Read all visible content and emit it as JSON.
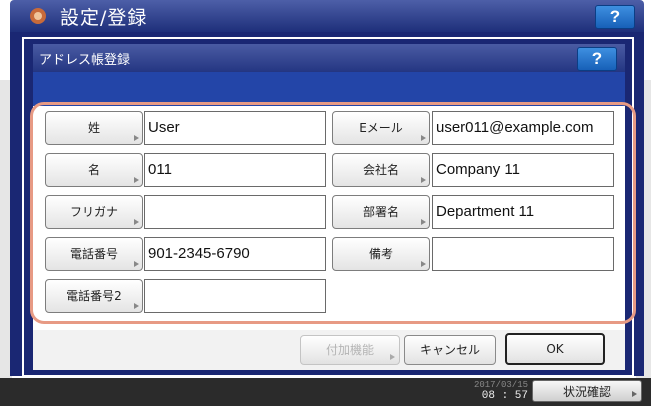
{
  "app": {
    "title": "設定/登録",
    "help_label": "?"
  },
  "dialog": {
    "title": "アドレス帳登録",
    "help_label": "?"
  },
  "fields": {
    "last_name": {
      "label": "姓",
      "value": "User"
    },
    "first_name": {
      "label": "名",
      "value": "011"
    },
    "furigana": {
      "label": "フリガナ",
      "value": ""
    },
    "phone": {
      "label": "電話番号",
      "value": "901-2345-6790"
    },
    "phone2": {
      "label": "電話番号2",
      "value": ""
    },
    "email": {
      "label": "Eメール",
      "value": "user011@example.com"
    },
    "company": {
      "label": "会社名",
      "value": "Company 11"
    },
    "department": {
      "label": "部署名",
      "value": "Department 11"
    },
    "notes": {
      "label": "備考",
      "value": ""
    }
  },
  "buttons": {
    "extra_label": "付加機能",
    "cancel_label": "キャンセル",
    "ok_label": "OK"
  },
  "statusbar": {
    "date": "2017/03/15",
    "time": "08 : 57",
    "status_label": "状況確認"
  },
  "colors": {
    "title_bar": "#1e2f7a",
    "highlight": "#e79a84",
    "help": "#1760b8"
  }
}
